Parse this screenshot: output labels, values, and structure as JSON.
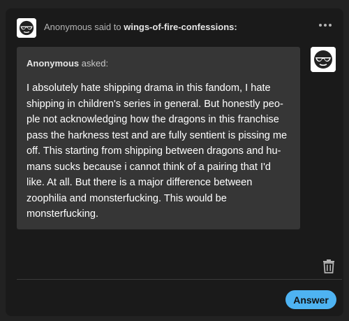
{
  "header": {
    "sender": "Anonymous",
    "said_to": "said to",
    "blog": "wings-of-fire-confessions:",
    "more_icon": "more-horizontal-icon"
  },
  "question": {
    "asker": "Anonymous",
    "asked": "asked:",
    "lines": [
      "I absolutely hate shipping drama in this fandom, I hate",
      "shipping in children's series in general. But honestly peo-",
      "ple not acknowledging how the dragons in this franchise",
      "pass the harkness test and are fully sentient is pissing me",
      "off. This starting from shipping between dragons and hu-",
      "mans sucks because i cannot think of a pairing that I'd",
      "like. At all. But there is a major difference between",
      "zoophilia and monsterfucking. This would be",
      "monsterfucking."
    ]
  },
  "icons": {
    "avatar": "anonymous-sunglasses-avatar-icon",
    "trash": "trash-icon"
  },
  "actions": {
    "answer_label": "Answer"
  },
  "colors": {
    "accent": "#4eb3f2",
    "background": "#1a1a1a",
    "bubble": "#363636"
  }
}
